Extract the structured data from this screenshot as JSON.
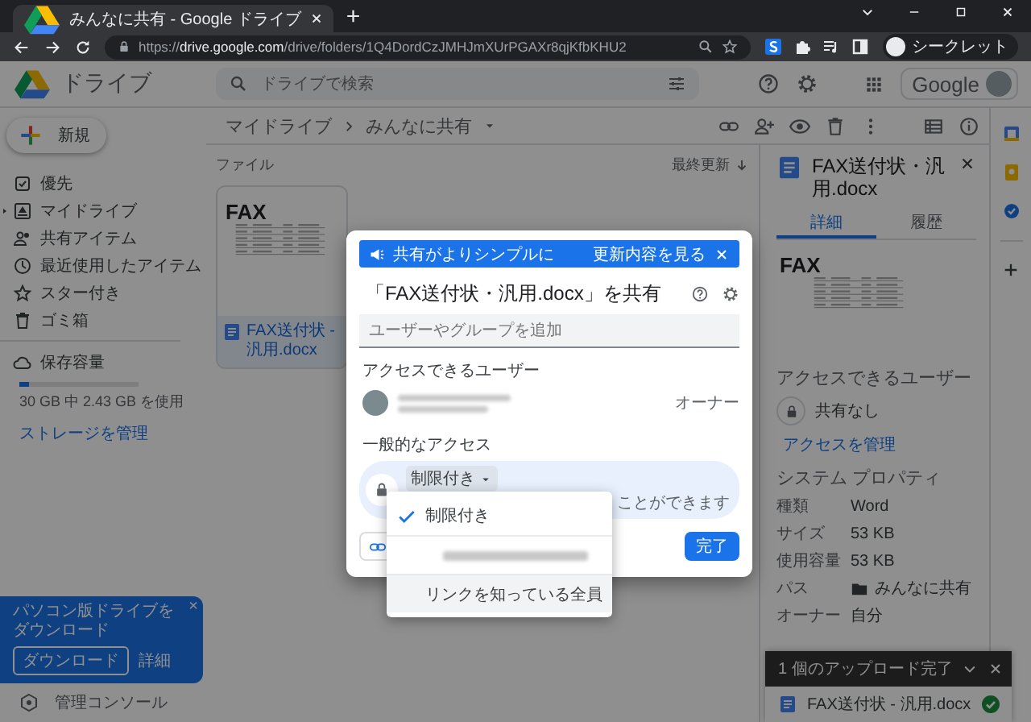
{
  "browser": {
    "tab_title": "みんなに共有 - Google ドライブ",
    "new_tab": "+",
    "url_scheme": "https://",
    "url_host": "drive.google.com",
    "url_path": "/drive/folders/1Q4DordCzJMHJmXUrPGAXr8qjKfbKHU2",
    "profile": "シークレット"
  },
  "header": {
    "logo_text": "ドライブ",
    "search_placeholder": "ドライブで検索",
    "account_text": "Google"
  },
  "sidebar": {
    "new_button": "新規",
    "nav": [
      {
        "label": "優先",
        "selected": false
      },
      {
        "label": "マイドライブ",
        "selected": false
      },
      {
        "label": "共有アイテム",
        "selected": false
      },
      {
        "label": "最近使用したアイテム",
        "selected": false
      },
      {
        "label": "スター付き",
        "selected": false
      },
      {
        "label": "ゴミ箱",
        "selected": false
      }
    ],
    "storage": {
      "label": "保存容量",
      "level": 0.08,
      "usage": "30 GB 中 2.43 GB を使用",
      "manage": "ストレージを管理"
    },
    "promo": {
      "title": "パソコン版ドライブをダウンロード",
      "close": "×",
      "download": "ダウンロード",
      "details": "詳細"
    },
    "admin": "管理コンソール"
  },
  "toolbar": {
    "breadcrumb": [
      "マイドライブ",
      "みんなに共有"
    ]
  },
  "files": {
    "heading": "ファイル",
    "sort_label": "最終更新",
    "cards": [
      {
        "name": "FAX送付状 - 汎用.docx",
        "preview_title": "FAX"
      }
    ]
  },
  "details": {
    "title": "FAX送付状・汎用.docx",
    "tabs": [
      {
        "label": "詳細",
        "selected": true
      },
      {
        "label": "履歴",
        "selected": false
      }
    ],
    "preview_title": "FAX",
    "access_heading": "アクセスできるユーザー",
    "access_status": "共有なし",
    "manage_access": "アクセスを管理",
    "props_heading": "システム プロパティ",
    "props": [
      {
        "label": "種類",
        "value": "Word",
        "kind": "text"
      },
      {
        "label": "サイズ",
        "value": "53 KB",
        "kind": "text"
      },
      {
        "label": "使用容量",
        "value": "53 KB",
        "kind": "text"
      },
      {
        "label": "パス",
        "value": "みんなに共有",
        "kind": "folder"
      },
      {
        "label": "オーナー",
        "value": "自分",
        "kind": "text"
      }
    ]
  },
  "upload": {
    "title": "1 個のアップロード完了",
    "files": [
      {
        "name": "FAX送付状 - 汎用.docx",
        "done": true
      }
    ]
  },
  "share_dialog": {
    "banner_text": "共有がよりシンプルに",
    "banner_link": "更新内容を見る",
    "title": "「FAX送付状・汎用.docx」を共有",
    "add_placeholder": "ユーザーやグループを追加",
    "people_heading": "アクセスできるユーザー",
    "owner_role": "オーナー",
    "general_heading": "一般的なアクセス",
    "access_button": "制限付き",
    "access_hint": "ことができます",
    "done": "完了"
  },
  "access_menu": [
    {
      "kind": "text",
      "label": "制限付き",
      "selected": true,
      "highlighted": false
    },
    {
      "kind": "redacted",
      "selected": false,
      "highlighted": false
    },
    {
      "kind": "text",
      "label": "リンクを知っている全員",
      "selected": false,
      "highlighted": true
    }
  ]
}
